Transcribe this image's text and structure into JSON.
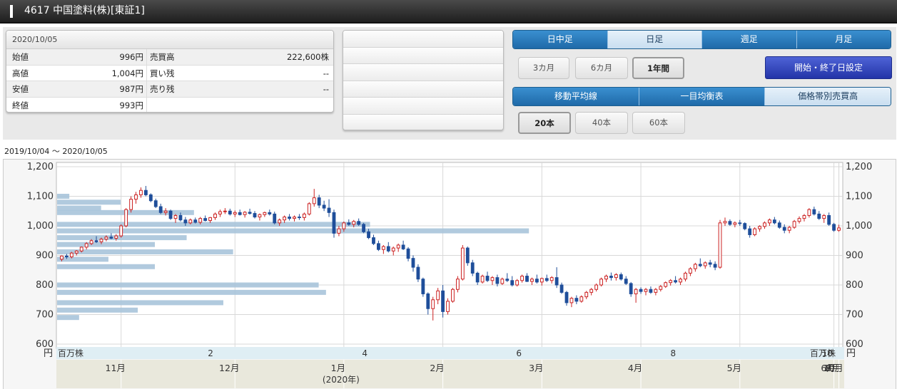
{
  "header": {
    "title": "4617 中国塗料(株)[東証1]"
  },
  "quote": {
    "date": "2020/10/05",
    "rows": [
      {
        "label": "始値",
        "value": "996円",
        "label2": "売買高",
        "value2": "222,600株"
      },
      {
        "label": "高値",
        "value": "1,004円",
        "label2": "買い残",
        "value2": "--"
      },
      {
        "label": "安値",
        "value": "987円",
        "label2": "売り残",
        "value2": "--"
      },
      {
        "label": "終値",
        "value": "993円",
        "label2": "",
        "value2": ""
      }
    ]
  },
  "period_tabs": [
    "日中足",
    "日足",
    "週足",
    "月足"
  ],
  "period_active": "日足",
  "range_buttons": [
    "3カ月",
    "6カ月",
    "1年間"
  ],
  "range_active": "1年間",
  "set_dates_button": "開始・終了日設定",
  "indicator_tabs": [
    "移動平均線",
    "一目均衡表",
    "価格帯別売買高"
  ],
  "indicator_active": "価格帯別売買高",
  "ma_buttons": [
    "20本",
    "40本",
    "60本"
  ],
  "ma_active": "20本",
  "date_range": "2019/10/04 〜 2020/10/05",
  "colors": {
    "up": "#cc2222",
    "down": "#1f4e9a",
    "volume_bar": "#a9c4da",
    "axis_band": "#dfeef4",
    "month_band": "#e9e8dc"
  },
  "chart_data": {
    "type": "candlestick",
    "ylim": [
      600,
      1200
    ],
    "y_ticks": [
      600,
      700,
      800,
      900,
      1000,
      1100,
      1200
    ],
    "y_tick_labels": [
      "600",
      "700",
      "800",
      "900",
      "1,000",
      "1,100",
      "1,200"
    ],
    "left_unit": "円",
    "right_unit": "円",
    "volume_unit": "百万株",
    "volume_ticks": [
      "2",
      "4",
      "6",
      "8",
      "10"
    ],
    "volume_tick_values": [
      2,
      4,
      6,
      8,
      10
    ],
    "volume_max": 10.2,
    "months": [
      "11月",
      "12月",
      "1月",
      "2月",
      "3月",
      "4月",
      "5月",
      "6月",
      "7月",
      "8月",
      "9月",
      "10月"
    ],
    "year_label": "(2020年)",
    "volume_profile": [
      {
        "price": 1100,
        "volume": 0.5
      },
      {
        "price": 1080,
        "volume": 2.6
      },
      {
        "price": 1060,
        "volume": 1.8
      },
      {
        "price": 1045,
        "volume": 5.6
      },
      {
        "price": 1005,
        "volume": 12.8
      },
      {
        "price": 983,
        "volume": 19.3
      },
      {
        "price": 960,
        "volume": 5.3
      },
      {
        "price": 937,
        "volume": 4.0
      },
      {
        "price": 912,
        "volume": 7.2
      },
      {
        "price": 887,
        "volume": 2.1
      },
      {
        "price": 862,
        "volume": 4.0
      },
      {
        "price": 800,
        "volume": 10.7
      },
      {
        "price": 775,
        "volume": 11.0
      },
      {
        "price": 740,
        "volume": 6.8
      },
      {
        "price": 715,
        "volume": 3.3
      },
      {
        "price": 690,
        "volume": 0.9
      }
    ],
    "candles": [
      [
        887,
        900,
        880,
        898
      ],
      [
        898,
        905,
        888,
        895
      ],
      [
        895,
        912,
        890,
        908
      ],
      [
        908,
        918,
        900,
        915
      ],
      [
        915,
        930,
        910,
        928
      ],
      [
        928,
        945,
        920,
        940
      ],
      [
        940,
        955,
        935,
        950
      ],
      [
        950,
        965,
        942,
        946
      ],
      [
        946,
        960,
        938,
        955
      ],
      [
        955,
        968,
        948,
        962
      ],
      [
        962,
        975,
        955,
        958
      ],
      [
        958,
        972,
        950,
        966
      ],
      [
        966,
        1005,
        960,
        1000
      ],
      [
        1000,
        1060,
        995,
        1055
      ],
      [
        1055,
        1100,
        1045,
        1090
      ],
      [
        1090,
        1115,
        1075,
        1105
      ],
      [
        1105,
        1130,
        1095,
        1120
      ],
      [
        1120,
        1135,
        1100,
        1105
      ],
      [
        1105,
        1110,
        1080,
        1085
      ],
      [
        1085,
        1092,
        1060,
        1065
      ],
      [
        1065,
        1075,
        1040,
        1045
      ],
      [
        1045,
        1060,
        1035,
        1050
      ],
      [
        1050,
        1055,
        1020,
        1025
      ],
      [
        1025,
        1040,
        1010,
        1035
      ],
      [
        1035,
        1045,
        1015,
        1020
      ],
      [
        1020,
        1030,
        1000,
        1010
      ],
      [
        1010,
        1025,
        1005,
        1020
      ],
      [
        1020,
        1028,
        1008,
        1012
      ],
      [
        1012,
        1030,
        1005,
        1025
      ],
      [
        1025,
        1035,
        1015,
        1018
      ],
      [
        1018,
        1030,
        1010,
        1028
      ],
      [
        1028,
        1045,
        1020,
        1040
      ],
      [
        1040,
        1055,
        1030,
        1048
      ],
      [
        1048,
        1060,
        1040,
        1050
      ],
      [
        1050,
        1058,
        1035,
        1040
      ],
      [
        1040,
        1052,
        1030,
        1045
      ],
      [
        1045,
        1055,
        1035,
        1038
      ],
      [
        1038,
        1050,
        1028,
        1046
      ],
      [
        1046,
        1058,
        1038,
        1042
      ],
      [
        1042,
        1050,
        1025,
        1030
      ],
      [
        1030,
        1042,
        1018,
        1038
      ],
      [
        1038,
        1048,
        1030,
        1045
      ],
      [
        1045,
        1055,
        1035,
        1040
      ],
      [
        1040,
        1048,
        1005,
        1010
      ],
      [
        1010,
        1025,
        1000,
        1020
      ],
      [
        1020,
        1035,
        1010,
        1030
      ],
      [
        1030,
        1040,
        1018,
        1025
      ],
      [
        1025,
        1035,
        1015,
        1030
      ],
      [
        1030,
        1040,
        1020,
        1028
      ],
      [
        1028,
        1045,
        1018,
        1040
      ],
      [
        1040,
        1080,
        1035,
        1075
      ],
      [
        1075,
        1125,
        1065,
        1095
      ],
      [
        1095,
        1105,
        1060,
        1070
      ],
      [
        1070,
        1085,
        1050,
        1060
      ],
      [
        1060,
        1090,
        1030,
        1045
      ],
      [
        1045,
        1055,
        960,
        975
      ],
      [
        975,
        1000,
        965,
        990
      ],
      [
        990,
        1015,
        980,
        1010
      ],
      [
        1010,
        1022,
        1000,
        1005
      ],
      [
        1005,
        1020,
        995,
        1015
      ],
      [
        1015,
        1025,
        1000,
        1005
      ],
      [
        1005,
        1010,
        975,
        980
      ],
      [
        980,
        990,
        955,
        960
      ],
      [
        960,
        970,
        935,
        940
      ],
      [
        940,
        950,
        915,
        920
      ],
      [
        920,
        935,
        905,
        930
      ],
      [
        930,
        945,
        910,
        915
      ],
      [
        915,
        930,
        900,
        925
      ],
      [
        925,
        940,
        912,
        935
      ],
      [
        935,
        950,
        918,
        922
      ],
      [
        922,
        928,
        880,
        890
      ],
      [
        890,
        900,
        845,
        860
      ],
      [
        860,
        870,
        810,
        820
      ],
      [
        820,
        825,
        760,
        770
      ],
      [
        770,
        775,
        700,
        720
      ],
      [
        720,
        760,
        680,
        750
      ],
      [
        750,
        790,
        735,
        780
      ],
      [
        780,
        800,
        690,
        710
      ],
      [
        710,
        755,
        700,
        745
      ],
      [
        745,
        790,
        740,
        785
      ],
      [
        785,
        830,
        775,
        820
      ],
      [
        820,
        935,
        815,
        925
      ],
      [
        925,
        930,
        865,
        875
      ],
      [
        875,
        885,
        830,
        840
      ],
      [
        840,
        845,
        800,
        810
      ],
      [
        810,
        835,
        805,
        830
      ],
      [
        830,
        845,
        810,
        815
      ],
      [
        815,
        830,
        800,
        825
      ],
      [
        825,
        835,
        795,
        805
      ],
      [
        805,
        825,
        800,
        820
      ],
      [
        820,
        840,
        810,
        815
      ],
      [
        815,
        830,
        795,
        800
      ],
      [
        800,
        820,
        795,
        815
      ],
      [
        815,
        835,
        808,
        830
      ],
      [
        830,
        840,
        810,
        812
      ],
      [
        812,
        825,
        800,
        820
      ],
      [
        820,
        835,
        805,
        810
      ],
      [
        810,
        825,
        798,
        822
      ],
      [
        822,
        835,
        810,
        815
      ],
      [
        815,
        830,
        805,
        825
      ],
      [
        825,
        860,
        790,
        800
      ],
      [
        800,
        808,
        770,
        775
      ],
      [
        775,
        780,
        730,
        740
      ],
      [
        740,
        760,
        725,
        755
      ],
      [
        755,
        765,
        735,
        745
      ],
      [
        745,
        765,
        740,
        760
      ],
      [
        760,
        780,
        752,
        775
      ],
      [
        775,
        790,
        765,
        785
      ],
      [
        785,
        805,
        778,
        800
      ],
      [
        800,
        825,
        795,
        820
      ],
      [
        820,
        835,
        810,
        830
      ],
      [
        830,
        842,
        815,
        825
      ],
      [
        825,
        840,
        815,
        835
      ],
      [
        835,
        842,
        815,
        820
      ],
      [
        820,
        830,
        800,
        805
      ],
      [
        805,
        810,
        760,
        770
      ],
      [
        770,
        790,
        740,
        785
      ],
      [
        785,
        792,
        770,
        778
      ],
      [
        778,
        790,
        765,
        785
      ],
      [
        785,
        795,
        770,
        775
      ],
      [
        775,
        790,
        765,
        785
      ],
      [
        785,
        800,
        778,
        795
      ],
      [
        795,
        812,
        790,
        808
      ],
      [
        808,
        820,
        798,
        815
      ],
      [
        815,
        830,
        805,
        810
      ],
      [
        810,
        825,
        800,
        820
      ],
      [
        820,
        845,
        812,
        840
      ],
      [
        840,
        860,
        830,
        855
      ],
      [
        855,
        875,
        845,
        870
      ],
      [
        870,
        890,
        860,
        865
      ],
      [
        865,
        880,
        855,
        875
      ],
      [
        875,
        885,
        860,
        870
      ],
      [
        870,
        880,
        850,
        860
      ],
      [
        860,
        1020,
        855,
        1010
      ],
      [
        1010,
        1028,
        1000,
        1015
      ],
      [
        1015,
        1022,
        1000,
        1005
      ],
      [
        1005,
        1015,
        995,
        1010
      ],
      [
        1010,
        1020,
        1000,
        1008
      ],
      [
        1008,
        1012,
        985,
        990
      ],
      [
        990,
        1000,
        960,
        970
      ],
      [
        970,
        995,
        965,
        990
      ],
      [
        990,
        1002,
        980,
        998
      ],
      [
        998,
        1015,
        990,
        1010
      ],
      [
        1010,
        1025,
        1000,
        1020
      ],
      [
        1020,
        1030,
        1005,
        1010
      ],
      [
        1010,
        1018,
        990,
        995
      ],
      [
        995,
        1005,
        975,
        985
      ],
      [
        985,
        1000,
        975,
        995
      ],
      [
        995,
        1020,
        990,
        1015
      ],
      [
        1015,
        1032,
        1008,
        1025
      ],
      [
        1025,
        1040,
        1015,
        1035
      ],
      [
        1035,
        1060,
        1028,
        1055
      ],
      [
        1055,
        1065,
        1035,
        1040
      ],
      [
        1040,
        1050,
        1020,
        1025
      ],
      [
        1025,
        1040,
        1010,
        1035
      ],
      [
        1035,
        1045,
        1000,
        1005
      ],
      [
        1005,
        1010,
        980,
        985
      ],
      [
        985,
        1004,
        980,
        993
      ]
    ]
  }
}
